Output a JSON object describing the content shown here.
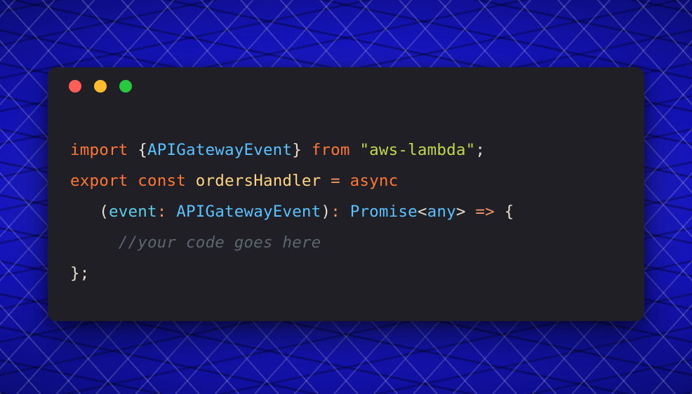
{
  "window": {
    "colors": {
      "close": "#ff5f56",
      "minimize": "#ffbd2e",
      "zoom": "#27c93f"
    }
  },
  "code": {
    "line1": {
      "kw_import": "import",
      "brace_open": "{",
      "type": "APIGatewayEvent",
      "brace_close": "}",
      "kw_from": "from",
      "str": "\"aws-lambda\"",
      "semi": ";"
    },
    "line2": {
      "kw_export": "export",
      "kw_const": "const",
      "fn_name": "ordersHandler",
      "eq": "=",
      "kw_async": "async"
    },
    "line3": {
      "paren_open": "(",
      "param": "event",
      "colon": ":",
      "param_type": "APIGatewayEvent",
      "paren_close": ")",
      "colon2": ":",
      "ret_type": "Promise",
      "lt": "<",
      "any": "any",
      "gt": ">",
      "arrow": "=>",
      "brace_open": "{"
    },
    "line4": {
      "comment": "//your code goes here"
    },
    "line5": {
      "brace_close": "}",
      "semi": ";"
    }
  }
}
